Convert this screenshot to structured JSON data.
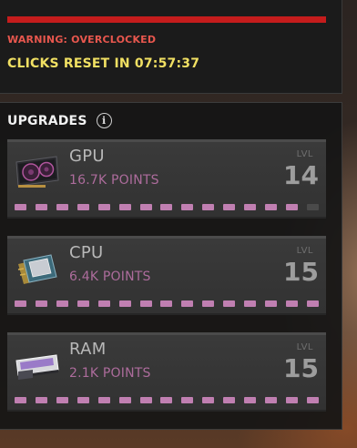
{
  "status": {
    "warning_text": "WARNING: OVERCLOCKED",
    "reset_text": "CLICKS RESET IN 07:57:37",
    "warning_bar_color": "#c51c1c"
  },
  "upgrades": {
    "title": "UPGRADES",
    "info_icon": "info-icon",
    "items": [
      {
        "name": "GPU",
        "points": "16.7K POINTS",
        "lvl_label": "LVL",
        "level": "14",
        "segments_total": 15,
        "segments_filled": 14,
        "icon": "gpu-card-icon"
      },
      {
        "name": "CPU",
        "points": "6.4K POINTS",
        "lvl_label": "LVL",
        "level": "15",
        "segments_total": 15,
        "segments_filled": 15,
        "icon": "cpu-chip-icon"
      },
      {
        "name": "RAM",
        "points": "2.1K POINTS",
        "lvl_label": "LVL",
        "level": "15",
        "segments_total": 15,
        "segments_filled": 15,
        "icon": "ram-stick-icon"
      }
    ]
  },
  "colors": {
    "points_text": "#ad6c9c",
    "progress_fill": "#c07fb1",
    "reset_text": "#f1e063",
    "warning_text": "#e8574e"
  }
}
